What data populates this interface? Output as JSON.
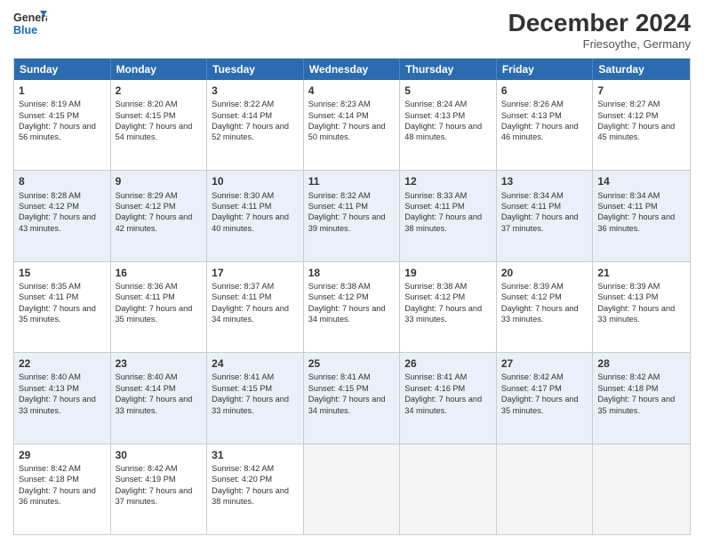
{
  "logo": {
    "line1": "General",
    "line2": "Blue"
  },
  "title": "December 2024",
  "location": "Friesoythe, Germany",
  "days_of_week": [
    "Sunday",
    "Monday",
    "Tuesday",
    "Wednesday",
    "Thursday",
    "Friday",
    "Saturday"
  ],
  "weeks": [
    [
      {
        "day": "1",
        "sunrise": "Sunrise: 8:19 AM",
        "sunset": "Sunset: 4:15 PM",
        "daylight": "Daylight: 7 hours and 56 minutes."
      },
      {
        "day": "2",
        "sunrise": "Sunrise: 8:20 AM",
        "sunset": "Sunset: 4:15 PM",
        "daylight": "Daylight: 7 hours and 54 minutes."
      },
      {
        "day": "3",
        "sunrise": "Sunrise: 8:22 AM",
        "sunset": "Sunset: 4:14 PM",
        "daylight": "Daylight: 7 hours and 52 minutes."
      },
      {
        "day": "4",
        "sunrise": "Sunrise: 8:23 AM",
        "sunset": "Sunset: 4:14 PM",
        "daylight": "Daylight: 7 hours and 50 minutes."
      },
      {
        "day": "5",
        "sunrise": "Sunrise: 8:24 AM",
        "sunset": "Sunset: 4:13 PM",
        "daylight": "Daylight: 7 hours and 48 minutes."
      },
      {
        "day": "6",
        "sunrise": "Sunrise: 8:26 AM",
        "sunset": "Sunset: 4:13 PM",
        "daylight": "Daylight: 7 hours and 46 minutes."
      },
      {
        "day": "7",
        "sunrise": "Sunrise: 8:27 AM",
        "sunset": "Sunset: 4:12 PM",
        "daylight": "Daylight: 7 hours and 45 minutes."
      }
    ],
    [
      {
        "day": "8",
        "sunrise": "Sunrise: 8:28 AM",
        "sunset": "Sunset: 4:12 PM",
        "daylight": "Daylight: 7 hours and 43 minutes."
      },
      {
        "day": "9",
        "sunrise": "Sunrise: 8:29 AM",
        "sunset": "Sunset: 4:12 PM",
        "daylight": "Daylight: 7 hours and 42 minutes."
      },
      {
        "day": "10",
        "sunrise": "Sunrise: 8:30 AM",
        "sunset": "Sunset: 4:11 PM",
        "daylight": "Daylight: 7 hours and 40 minutes."
      },
      {
        "day": "11",
        "sunrise": "Sunrise: 8:32 AM",
        "sunset": "Sunset: 4:11 PM",
        "daylight": "Daylight: 7 hours and 39 minutes."
      },
      {
        "day": "12",
        "sunrise": "Sunrise: 8:33 AM",
        "sunset": "Sunset: 4:11 PM",
        "daylight": "Daylight: 7 hours and 38 minutes."
      },
      {
        "day": "13",
        "sunrise": "Sunrise: 8:34 AM",
        "sunset": "Sunset: 4:11 PM",
        "daylight": "Daylight: 7 hours and 37 minutes."
      },
      {
        "day": "14",
        "sunrise": "Sunrise: 8:34 AM",
        "sunset": "Sunset: 4:11 PM",
        "daylight": "Daylight: 7 hours and 36 minutes."
      }
    ],
    [
      {
        "day": "15",
        "sunrise": "Sunrise: 8:35 AM",
        "sunset": "Sunset: 4:11 PM",
        "daylight": "Daylight: 7 hours and 35 minutes."
      },
      {
        "day": "16",
        "sunrise": "Sunrise: 8:36 AM",
        "sunset": "Sunset: 4:11 PM",
        "daylight": "Daylight: 7 hours and 35 minutes."
      },
      {
        "day": "17",
        "sunrise": "Sunrise: 8:37 AM",
        "sunset": "Sunset: 4:11 PM",
        "daylight": "Daylight: 7 hours and 34 minutes."
      },
      {
        "day": "18",
        "sunrise": "Sunrise: 8:38 AM",
        "sunset": "Sunset: 4:12 PM",
        "daylight": "Daylight: 7 hours and 34 minutes."
      },
      {
        "day": "19",
        "sunrise": "Sunrise: 8:38 AM",
        "sunset": "Sunset: 4:12 PM",
        "daylight": "Daylight: 7 hours and 33 minutes."
      },
      {
        "day": "20",
        "sunrise": "Sunrise: 8:39 AM",
        "sunset": "Sunset: 4:12 PM",
        "daylight": "Daylight: 7 hours and 33 minutes."
      },
      {
        "day": "21",
        "sunrise": "Sunrise: 8:39 AM",
        "sunset": "Sunset: 4:13 PM",
        "daylight": "Daylight: 7 hours and 33 minutes."
      }
    ],
    [
      {
        "day": "22",
        "sunrise": "Sunrise: 8:40 AM",
        "sunset": "Sunset: 4:13 PM",
        "daylight": "Daylight: 7 hours and 33 minutes."
      },
      {
        "day": "23",
        "sunrise": "Sunrise: 8:40 AM",
        "sunset": "Sunset: 4:14 PM",
        "daylight": "Daylight: 7 hours and 33 minutes."
      },
      {
        "day": "24",
        "sunrise": "Sunrise: 8:41 AM",
        "sunset": "Sunset: 4:15 PM",
        "daylight": "Daylight: 7 hours and 33 minutes."
      },
      {
        "day": "25",
        "sunrise": "Sunrise: 8:41 AM",
        "sunset": "Sunset: 4:15 PM",
        "daylight": "Daylight: 7 hours and 34 minutes."
      },
      {
        "day": "26",
        "sunrise": "Sunrise: 8:41 AM",
        "sunset": "Sunset: 4:16 PM",
        "daylight": "Daylight: 7 hours and 34 minutes."
      },
      {
        "day": "27",
        "sunrise": "Sunrise: 8:42 AM",
        "sunset": "Sunset: 4:17 PM",
        "daylight": "Daylight: 7 hours and 35 minutes."
      },
      {
        "day": "28",
        "sunrise": "Sunrise: 8:42 AM",
        "sunset": "Sunset: 4:18 PM",
        "daylight": "Daylight: 7 hours and 35 minutes."
      }
    ],
    [
      {
        "day": "29",
        "sunrise": "Sunrise: 8:42 AM",
        "sunset": "Sunset: 4:18 PM",
        "daylight": "Daylight: 7 hours and 36 minutes."
      },
      {
        "day": "30",
        "sunrise": "Sunrise: 8:42 AM",
        "sunset": "Sunset: 4:19 PM",
        "daylight": "Daylight: 7 hours and 37 minutes."
      },
      {
        "day": "31",
        "sunrise": "Sunrise: 8:42 AM",
        "sunset": "Sunset: 4:20 PM",
        "daylight": "Daylight: 7 hours and 38 minutes."
      },
      null,
      null,
      null,
      null
    ]
  ]
}
